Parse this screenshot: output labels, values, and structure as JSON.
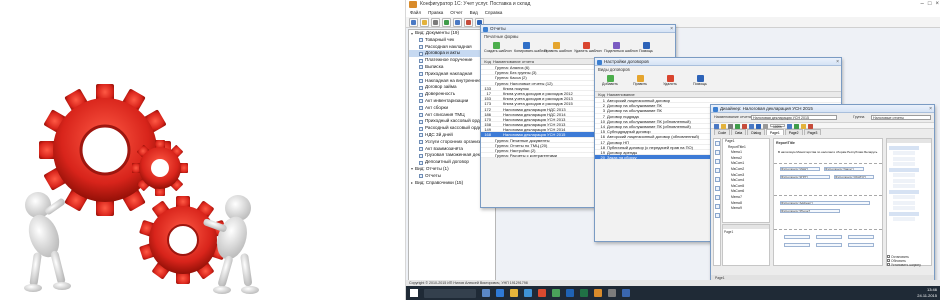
{
  "app": {
    "title": "Конфигуратор 1С: Учет услуг. Поставка и склад",
    "menu": [
      "Файл",
      "Правка",
      "Отчет",
      "Вид",
      "Справка"
    ]
  },
  "tree": {
    "root_documents": "Вид: Документы (19)",
    "documents": [
      "Товарный чек",
      "Расходная накладная",
      "Договора и акты",
      "Платежное поручение",
      "Выписка",
      "Приходная накладная",
      "Накладная на внутреннее пе",
      "Договор займа",
      "Доверенность",
      "Акт инвентаризации",
      "Акт сборки",
      "Акт списания ТМЦ",
      "Приходный кассовый ордер",
      "Расходный кассовый ордер",
      "НДС 3й дней",
      "Услуги сторонних организаций",
      "Акт взаимозачёта",
      "Грузовая таможенная декларация",
      "Депозитный договор"
    ],
    "selected_index": 2,
    "root_reports": "Вид: Отчеты (1)",
    "reports": [
      "Отчеты"
    ],
    "root_directories": "Вид: Справочники (15)"
  },
  "reports_window": {
    "title": "Отчеты",
    "subtitle": "Печатные формы",
    "tools": [
      "Создать шаблон",
      "Копировать шаблон",
      "Править шаблон",
      "Удалить шаблон",
      "Поделиться шаблон",
      "Помощь"
    ],
    "columns": [
      "Код",
      "Наименование отчета"
    ],
    "rows": [
      {
        "code": "",
        "name": "Группа: Анализ (6)",
        "level": 0
      },
      {
        "code": "",
        "name": "Группа: Без группы (3)",
        "level": 0
      },
      {
        "code": "",
        "name": "Группа: Касса (2)",
        "level": 0
      },
      {
        "code": "",
        "name": "Группа: Налоговые отчеты (12)",
        "level": 0
      },
      {
        "code": "133",
        "name": "Книга покупок",
        "level": 1
      },
      {
        "code": "17",
        "name": "Книга учета доходов и расходов 2012",
        "level": 1
      },
      {
        "code": "153",
        "name": "Книга учета доходов и расходов 2013",
        "level": 1
      },
      {
        "code": "173",
        "name": "Книга учета доходов и расходов 2015",
        "level": 1
      },
      {
        "code": "172",
        "name": "Налоговая декларация НДС 2013",
        "level": 1
      },
      {
        "code": "186",
        "name": "Налоговая декларация НДС 2014",
        "level": 1
      },
      {
        "code": "170",
        "name": "Налоговая декларация УСН 2013",
        "level": 1
      },
      {
        "code": "158",
        "name": "Налоговая декларация УСН 2013",
        "level": 1
      },
      {
        "code": "149",
        "name": "Налоговая декларация УСН 2014",
        "level": 1
      },
      {
        "code": "168",
        "name": "Налоговая декларация УСН 2015",
        "level": 1
      },
      {
        "code": "",
        "name": "Группа: Печатные документы",
        "level": 0
      },
      {
        "code": "",
        "name": "Группа: Отчеты по ТМЦ (20)",
        "level": 0
      },
      {
        "code": "",
        "name": "Группа: Настройки (2)",
        "level": 0
      },
      {
        "code": "",
        "name": "Группа: Расчеты с контрагентами",
        "level": 0
      }
    ],
    "selected_index": 13
  },
  "contracts_window": {
    "title": "Настройки договоров",
    "subtitle": "Виды договоров",
    "tools": [
      "Добавить",
      "Править",
      "Удалить",
      "Помощь"
    ],
    "columns": [
      "Код",
      "Наименование"
    ],
    "rows": [
      {
        "code": "1",
        "name": "Авторский лицензионный договор"
      },
      {
        "code": "2",
        "name": "Договор на обслуживание ПК"
      },
      {
        "code": "3",
        "name": "Договор на обслуживание ПК"
      },
      {
        "code": "7",
        "name": "Договор подряда"
      },
      {
        "code": "10",
        "name": "Договор на обслуживание ПК (обновленный)"
      },
      {
        "code": "14",
        "name": "Договор на обслуживание ПК (обновленный)"
      },
      {
        "code": "15",
        "name": "Субподрядный договор"
      },
      {
        "code": "16",
        "name": "Авторский лицензионный договор (обновленный)"
      },
      {
        "code": "17",
        "name": "Договор НП"
      },
      {
        "code": "18",
        "name": "Публичный договор (с передачей прав на ПО)"
      },
      {
        "code": "19",
        "name": "Договор аренды"
      },
      {
        "code": "20",
        "name": "Заказ на сборку"
      }
    ],
    "selected_index": 11
  },
  "designer_window": {
    "title": "Дизайнер: Налоговая декларация УСН 2015",
    "toolbar_label": "Наименование отчета",
    "report_name": "Налоговая декларация УСН 2015",
    "group_label": "Группа",
    "group_value": "Налоговые отчеты",
    "tabs": [
      "Code",
      "Data",
      "Dialog",
      "Page1",
      "Page2",
      "Page3"
    ],
    "zoom": "100%",
    "page_title": "ReportTitle",
    "page_text": "В налоговую Министерства по налогам и сборам Республики Беларусь",
    "fields": [
      "[frxCompany.\"ИНН\"]",
      "[frxCompany.\"Name\"]",
      "[frxCompany.\"КПП\"]",
      "[frxCompany.\"OKATO\"]",
      "[frxCompany.\"Address\"]",
      "[frxCompany.\"Phone\"]"
    ],
    "tree_items": [
      "Page1",
      "ReportTitle1",
      "Memo1",
      "Memo2",
      "MsCom1",
      "MsCom2",
      "MsCom3",
      "MsCom4",
      "MsCom5",
      "MsCom6",
      "Memo7",
      "Memo8",
      "Memo9"
    ],
    "palette": [
      "Cancel",
      "Band",
      "Memo",
      "Pict",
      "Line",
      "Shape",
      "CheckBox",
      "Barcode",
      "Chart"
    ],
    "bottom_props": [
      "Остановить",
      "Обновить",
      "Установить ширину"
    ],
    "page_label": "Page1"
  },
  "status_text": "Copyright © 2010-2015 ИП Нилов Алексей Викторович, УНП 191291798",
  "clock": {
    "time": "13:46",
    "date": "24.11.2015"
  },
  "colors": {
    "gear": "#d8241b",
    "gear_dark": "#9e160f",
    "figure": "#eeeeee",
    "selection": "#3d7bd6",
    "taskbar": "#1f2a36"
  }
}
